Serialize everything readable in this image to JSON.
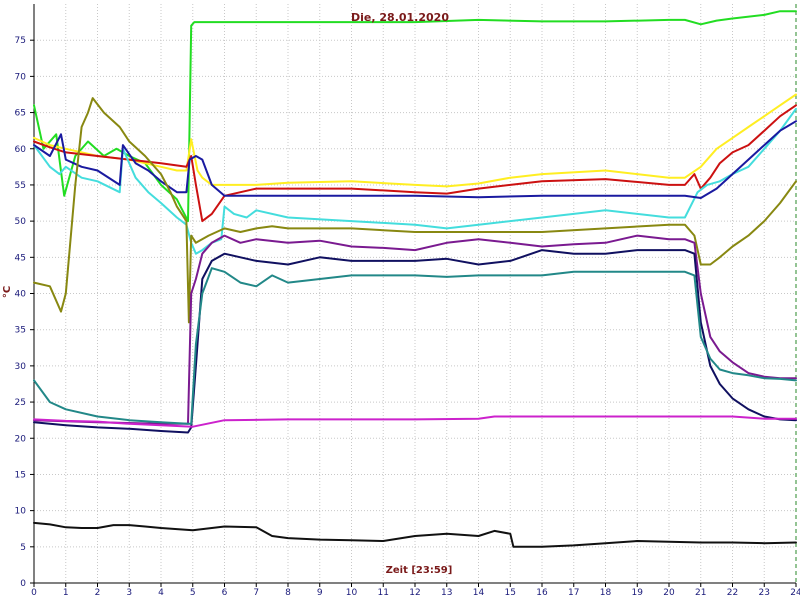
{
  "chart_data": {
    "type": "line",
    "title": "Die, 28.01.2020",
    "xlabel": "Zeit [23:59]",
    "ylabel": "°C",
    "xlim": [
      0,
      24
    ],
    "ylim": [
      0,
      80
    ],
    "x_ticks": [
      "0",
      "1",
      "2",
      "3",
      "4",
      "5",
      "6",
      "7",
      "8",
      "9",
      "10",
      "11",
      "12",
      "13",
      "14",
      "15",
      "16",
      "17",
      "18",
      "19",
      "20",
      "21",
      "22",
      "23",
      "24"
    ],
    "y_ticks": [
      "0",
      "5",
      "10",
      "15",
      "20",
      "25",
      "30",
      "35",
      "40",
      "45",
      "50",
      "55",
      "60",
      "65",
      "70",
      "75"
    ],
    "grid": true,
    "series": [
      {
        "color": "#22dd22",
        "x": [
          0,
          0.3,
          0.7,
          0.95,
          1.3,
          1.7,
          2.2,
          2.6,
          3.0,
          3.5,
          4.0,
          4.5,
          4.85,
          4.95,
          5.05,
          5.5,
          6,
          8,
          10,
          12,
          14,
          16,
          18,
          20,
          20.5,
          21,
          21.5,
          22,
          23,
          23.5,
          24
        ],
        "y": [
          66,
          60,
          62,
          53.5,
          59,
          61,
          59,
          60,
          59,
          58,
          55,
          53,
          50,
          77,
          77.5,
          77.5,
          77.5,
          77.5,
          77.5,
          77.5,
          77.8,
          77.6,
          77.6,
          77.8,
          77.8,
          77.2,
          77.7,
          78,
          78.5,
          79,
          79
        ]
      },
      {
        "color": "#ffee22",
        "x": [
          0,
          0.5,
          1,
          1.5,
          2,
          3,
          4,
          4.5,
          4.8,
          4.95,
          5.15,
          5.3,
          5.6,
          6,
          7,
          8,
          10,
          12,
          13,
          14,
          15,
          16,
          18,
          20,
          20.5,
          21,
          21.5,
          22,
          22.5,
          23,
          23.5,
          24
        ],
        "y": [
          61.5,
          60.5,
          60,
          59.5,
          59,
          58.5,
          57.5,
          57,
          57,
          61.3,
          57,
          56,
          55,
          55,
          55,
          55.3,
          55.5,
          55,
          54.8,
          55.2,
          56,
          56.5,
          57,
          56,
          56,
          57.5,
          60,
          61.5,
          63,
          64.5,
          66,
          67.5
        ]
      },
      {
        "color": "#cc1111",
        "x": [
          0,
          0.5,
          1,
          2,
          3,
          4,
          4.8,
          4.95,
          5.1,
          5.3,
          5.6,
          6,
          7,
          8,
          10,
          12,
          13,
          14,
          15,
          16,
          18,
          20,
          20.5,
          20.8,
          21,
          21.3,
          21.6,
          22,
          22.5,
          23,
          23.5,
          24
        ],
        "y": [
          61,
          60.2,
          59.5,
          59,
          58.5,
          58,
          57.5,
          59,
          55,
          50,
          51,
          53.5,
          54.5,
          54.5,
          54.5,
          54,
          53.8,
          54.5,
          55,
          55.5,
          55.8,
          55,
          55,
          56.5,
          54.5,
          56,
          58,
          59.5,
          60.5,
          62.5,
          64.5,
          66
        ]
      },
      {
        "color": "#44dddd",
        "x": [
          0,
          0.5,
          0.8,
          1,
          1.5,
          2,
          2.7,
          2.8,
          3.2,
          3.6,
          4,
          4.5,
          4.8,
          4.95,
          5.1,
          5.3,
          5.6,
          5.9,
          6,
          6.3,
          6.7,
          7,
          8,
          10,
          12,
          13,
          14,
          16,
          18,
          20,
          20.5,
          20.9,
          21.2,
          21.6,
          22,
          22.5,
          23,
          23.5,
          24
        ],
        "y": [
          60.5,
          57.5,
          56.5,
          57.5,
          56,
          55.5,
          54,
          60,
          56,
          54,
          52.5,
          50.5,
          49.5,
          47,
          45.5,
          46,
          47,
          47.5,
          52,
          51,
          50.5,
          51.5,
          50.5,
          50,
          49.5,
          49,
          49.5,
          50.5,
          51.5,
          50.5,
          50.5,
          54,
          55,
          55.5,
          56.5,
          57.5,
          60,
          62.5,
          65.5
        ]
      },
      {
        "color": "#1a1aa0",
        "x": [
          0,
          0.5,
          0.85,
          1,
          1.5,
          2,
          2.7,
          2.8,
          3.2,
          3.6,
          4,
          4.5,
          4.8,
          4.9,
          5.1,
          5.3,
          5.6,
          6,
          7,
          8,
          10,
          12,
          14,
          16,
          18,
          20,
          20.5,
          21,
          21.5,
          22,
          22.5,
          23,
          23.5,
          24
        ],
        "y": [
          60.5,
          59,
          62,
          58.5,
          57.5,
          57,
          55,
          60.5,
          58,
          57,
          55.5,
          54,
          54,
          58.5,
          59,
          58.5,
          55,
          53.5,
          53.5,
          53.5,
          53.5,
          53.5,
          53.3,
          53.5,
          53.5,
          53.5,
          53.5,
          53.2,
          54.5,
          56.5,
          58.5,
          60.5,
          62.5,
          63.8
        ]
      },
      {
        "color": "#888811",
        "x": [
          0,
          0.5,
          0.85,
          1,
          1.3,
          1.5,
          1.7,
          1.85,
          2.2,
          2.7,
          3,
          3.5,
          4,
          4.3,
          4.5,
          4.8,
          4.88,
          4.95,
          5.1,
          5.5,
          6,
          6.5,
          7,
          7.5,
          8,
          10,
          12,
          14,
          16,
          18,
          20,
          20.5,
          20.8,
          21,
          21.3,
          21.6,
          22,
          22.5,
          23,
          23.5,
          24
        ],
        "y": [
          41.5,
          41,
          37.5,
          40,
          55,
          63,
          65,
          67,
          65,
          63,
          61,
          59,
          56.5,
          54,
          52,
          50,
          36,
          48,
          47,
          48,
          49,
          48.5,
          49,
          49.3,
          49,
          49,
          48.5,
          48.5,
          48.5,
          49,
          49.5,
          49.5,
          48,
          44,
          44,
          45,
          46.5,
          48,
          50,
          52.5,
          55.5
        ]
      },
      {
        "color": "#7a1a90",
        "x": [
          0,
          2,
          4,
          4.85,
          4.95,
          5.1,
          5.3,
          5.6,
          6,
          6.5,
          7,
          8,
          9,
          10,
          11,
          12,
          13,
          14,
          15,
          16,
          17,
          18,
          19,
          20,
          20.5,
          20.8,
          21,
          21.3,
          21.6,
          22,
          22.5,
          23,
          23.5,
          24
        ],
        "y": [
          22.5,
          22.2,
          22,
          22,
          40,
          42,
          45.5,
          47,
          48,
          47,
          47.5,
          47,
          47.3,
          46.5,
          46.3,
          46,
          47,
          47.5,
          47,
          46.5,
          46.8,
          47,
          48,
          47.5,
          47.5,
          47,
          40,
          34,
          32,
          30.5,
          29,
          28.5,
          28.3,
          28.3
        ]
      },
      {
        "color": "#101060",
        "x": [
          0,
          1,
          2,
          3,
          4,
          4.85,
          4.95,
          5.1,
          5.3,
          5.6,
          6,
          6.5,
          7,
          8,
          9,
          10,
          11,
          12,
          13,
          14,
          15,
          16,
          17,
          18,
          19,
          20,
          20.5,
          20.8,
          21,
          21.3,
          21.6,
          22,
          22.5,
          23,
          23.5,
          24
        ],
        "y": [
          22.2,
          21.8,
          21.5,
          21.3,
          21,
          20.8,
          21.5,
          30,
          42,
          44.5,
          45.5,
          45,
          44.5,
          44,
          45,
          44.5,
          44.5,
          44.5,
          44.8,
          44,
          44.5,
          46,
          45.5,
          45.5,
          46,
          46,
          46,
          45.5,
          36,
          30,
          27.5,
          25.5,
          24,
          23,
          22.6,
          22.5
        ]
      },
      {
        "color": "#228888",
        "x": [
          0,
          0.5,
          1,
          2,
          3,
          4,
          4.85,
          4.95,
          5.1,
          5.3,
          5.6,
          6,
          6.5,
          7,
          7.5,
          8,
          9,
          10,
          11,
          12,
          13,
          14,
          15,
          16,
          17,
          18,
          19,
          20,
          20.5,
          20.8,
          21,
          21.3,
          21.6,
          22,
          22.5,
          23,
          23.5,
          24
        ],
        "y": [
          28,
          25,
          24,
          23,
          22.5,
          22.2,
          22,
          22,
          33,
          40,
          43.5,
          43,
          41.5,
          41,
          42.5,
          41.5,
          42,
          42.5,
          42.5,
          42.5,
          42.3,
          42.5,
          42.5,
          42.5,
          43,
          43,
          43,
          43,
          43,
          42.5,
          34,
          31,
          29.5,
          29,
          28.7,
          28.3,
          28.2,
          28
        ]
      },
      {
        "color": "#cc22cc",
        "x": [
          0,
          1,
          2,
          3,
          4,
          5,
          6,
          8,
          10,
          12,
          14,
          14.5,
          15,
          16,
          18,
          20,
          22,
          23,
          24
        ],
        "y": [
          22.6,
          22.4,
          22.3,
          22,
          21.8,
          21.6,
          22.5,
          22.6,
          22.6,
          22.6,
          22.7,
          23,
          23,
          23,
          23,
          23,
          23,
          22.7,
          22.7
        ]
      },
      {
        "color": "#111111",
        "x": [
          0,
          0.5,
          1,
          1.5,
          2,
          2.5,
          3,
          3.5,
          4,
          5,
          6,
          7,
          7.5,
          8,
          9,
          10,
          11,
          12,
          13,
          14,
          14.5,
          15,
          15.1,
          16,
          17,
          18,
          19,
          20,
          21,
          22,
          23,
          24
        ],
        "y": [
          8.3,
          8.1,
          7.7,
          7.6,
          7.6,
          8,
          8,
          7.8,
          7.6,
          7.3,
          7.8,
          7.7,
          6.5,
          6.2,
          6,
          5.9,
          5.8,
          6.5,
          6.8,
          6.5,
          7.2,
          6.8,
          5,
          5,
          5.2,
          5.5,
          5.8,
          5.7,
          5.6,
          5.6,
          5.5,
          5.6
        ]
      }
    ]
  }
}
